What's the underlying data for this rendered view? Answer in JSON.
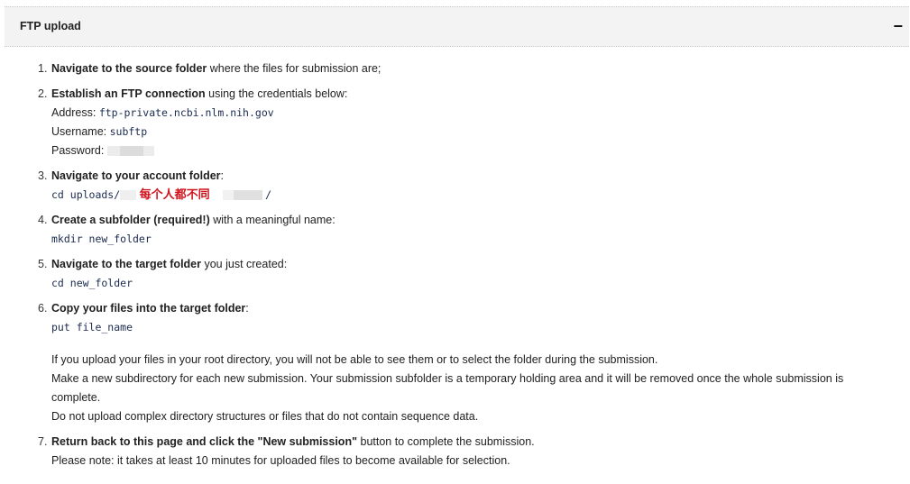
{
  "panel": {
    "title": "FTP upload",
    "collapse_symbol": "−"
  },
  "steps": [
    {
      "num": "1.",
      "bold": "Navigate to the source folder",
      "text": " where the files for submission are;"
    },
    {
      "num": "2.",
      "bold": "Establish an FTP connection",
      "text": " using the credentials below:",
      "address_label": "Address: ",
      "address_value": "ftp-private.ncbi.nlm.nih.gov",
      "username_label": "Username: ",
      "username_value": "subftp",
      "password_label": "Password: "
    },
    {
      "num": "3.",
      "bold": "Navigate to your account folder",
      "text": ":",
      "cmd_prefix": "cd uploads/",
      "note": "每个人都不同",
      "cmd_suffix": "/"
    },
    {
      "num": "4.",
      "bold": "Create a subfolder (required!)",
      "text": " with a meaningful name:",
      "cmd": "mkdir new_folder"
    },
    {
      "num": "5.",
      "bold": "Navigate to the target folder",
      "text": " you just created:",
      "cmd": "cd new_folder"
    },
    {
      "num": "6.",
      "bold": "Copy your files into the target folder",
      "text": ":",
      "cmd": "put file_name",
      "note1": "If you upload your files in your root directory, you will not be able to see them or to select the folder during the submission.",
      "note2": "Make a new subdirectory for each new submission. Your submission subfolder is a temporary holding area and it will be removed once the whole submission is complete.",
      "note3": "Do not upload complex directory structures or files that do not contain sequence data."
    },
    {
      "num": "7.",
      "bold": "Return back to this page and click the \"New submission\"",
      "text": " button to complete the submission.",
      "note": "Please note: it takes at least 10 minutes for uploaded files to become available for selection."
    }
  ]
}
